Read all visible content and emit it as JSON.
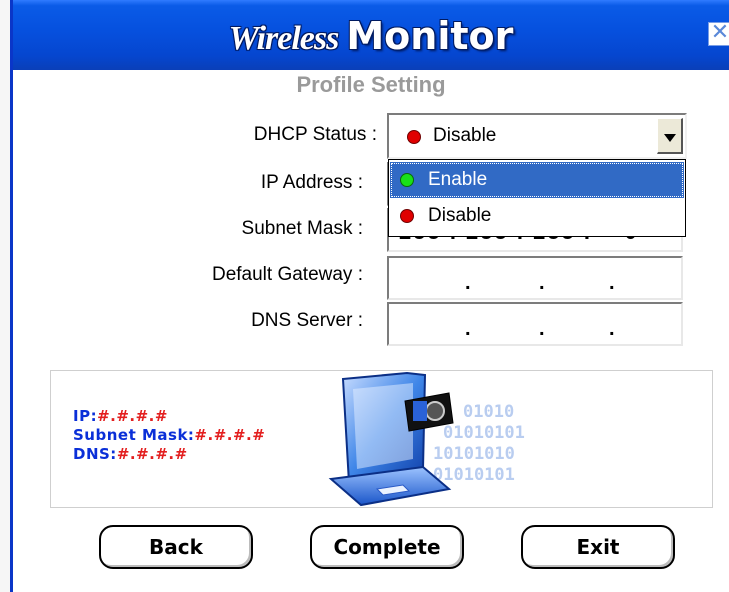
{
  "window": {
    "title_italic": "Wireless",
    "title_bold": "Monitor",
    "close_glyph": "✕"
  },
  "page": {
    "subtitle": "Profile Setting"
  },
  "form": {
    "dhcp_label": "DHCP Status :",
    "dhcp_value": "Disable",
    "dhcp_options": [
      {
        "label": "Enable",
        "dot_color": "#19e019",
        "highlighted": true
      },
      {
        "label": "Disable",
        "dot_color": "#e00000",
        "highlighted": false
      }
    ],
    "ip_label": "IP Address :",
    "subnet_label": "Subnet Mask :",
    "subnet_value_visible": "255 . 255 . 255 .    0",
    "gateway_label": "Default Gateway :",
    "dns_label": "DNS Server :",
    "empty_ip_separator": "."
  },
  "info_panel": {
    "ip_key": "IP:",
    "ip_val": "#.#.#.#",
    "mask_key": "Subnet Mask:",
    "mask_val": "#.#.#.#",
    "dns_key": "DNS:",
    "dns_val": "#.#.#.#",
    "binary_lines": [
      "01010",
      "01010101",
      "10101010",
      "01010101"
    ]
  },
  "buttons": {
    "back": "Back",
    "complete": "Complete",
    "exit": "Exit"
  },
  "colors": {
    "titlebar": "#0650de",
    "highlight": "#316ac5",
    "info_text": "#0a2fd8",
    "info_value": "#e31e1e"
  }
}
